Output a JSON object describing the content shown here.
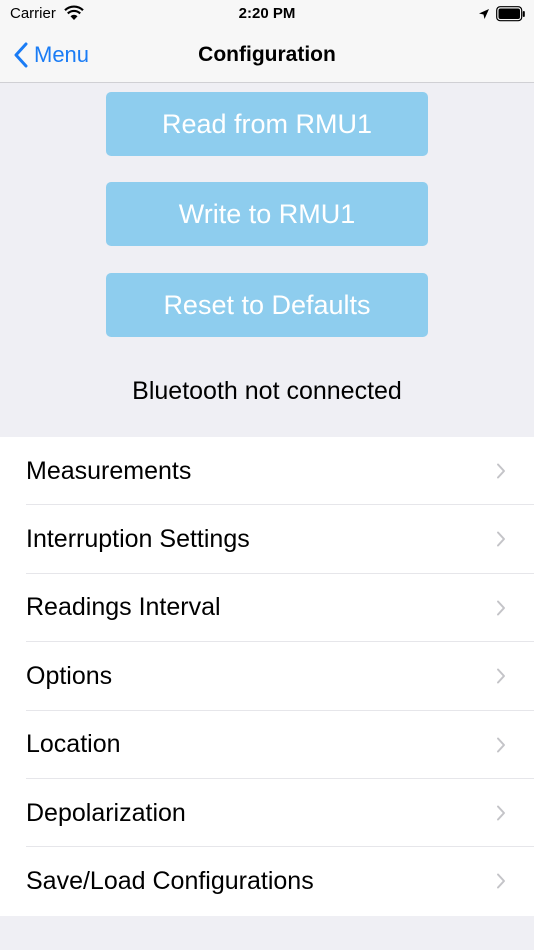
{
  "status_bar": {
    "carrier": "Carrier",
    "time": "2:20 PM",
    "icons": [
      "wifi-icon",
      "location-arrow-icon",
      "battery-icon"
    ]
  },
  "nav": {
    "back_label": "Menu",
    "title": "Configuration"
  },
  "actions": {
    "read_label": "Read from RMU1",
    "write_label": "Write to RMU1",
    "reset_label": "Reset to Defaults"
  },
  "connection_status": "Bluetooth not connected",
  "menu": {
    "items": [
      {
        "label": "Measurements"
      },
      {
        "label": "Interruption Settings"
      },
      {
        "label": "Readings Interval"
      },
      {
        "label": "Options"
      },
      {
        "label": "Location"
      },
      {
        "label": "Depolarization"
      },
      {
        "label": "Save/Load Configurations"
      }
    ]
  },
  "colors": {
    "accent": "#1a7cf5",
    "button_bg": "#8ecdee",
    "page_bg": "#efeff4"
  }
}
